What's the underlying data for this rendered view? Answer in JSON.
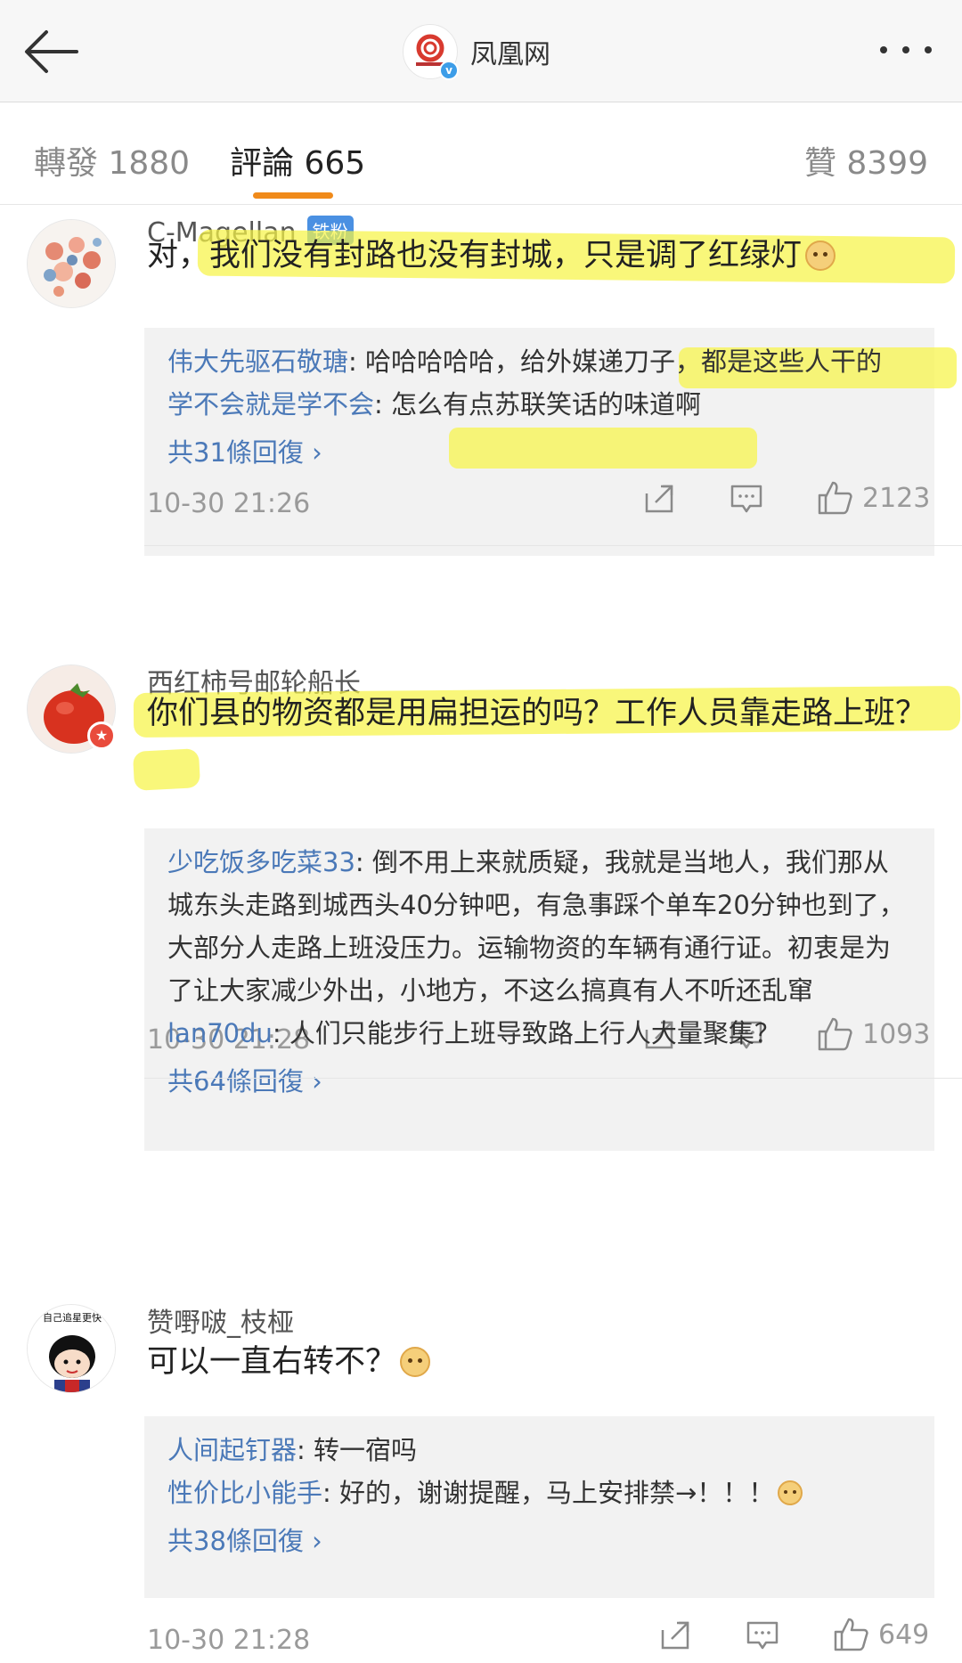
{
  "header": {
    "title": "凤凰网",
    "logo_text": "凤凰网",
    "verified_mark": "v"
  },
  "tabs": {
    "repost": "轉發 1880",
    "comments": "評論 665",
    "likes": "贊 8399"
  },
  "comments": [
    {
      "username": "C-Magellan",
      "badge": "铁粉",
      "text": "对，我们没有封路也没有封城，只是调了红绿灯",
      "replies": [
        {
          "name": "伟大先驱石敬瑭",
          "text": ": 哈哈哈哈哈，给外媒递刀子，都是这些人干的"
        },
        {
          "name": "学不会就是学不会",
          "text": ": 怎么有点苏联笑话的味道啊"
        }
      ],
      "more_replies": "共31條回復 ›",
      "time": "10-30 21:26",
      "likes": "2123"
    },
    {
      "username": "西红柿号邮轮船长",
      "badge": "",
      "text": "你们县的物资都是用扁担运的吗？工作人员靠走路上班？",
      "replies": [
        {
          "name": "少吃饭多吃菜33",
          "text": ": 倒不用上来就质疑，我就是当地人，我们那从城东头走路到城西头40分钟吧，有急事踩个单车20分钟也到了，大部分人走路上班没压力。运输物资的车辆有通行证。初衷是为了让大家减少外出，小地方，不这么搞真有人不听还乱窜"
        },
        {
          "name": "lan70du",
          "text": ": 人们只能步行上班导致路上行人大量聚集？"
        }
      ],
      "more_replies": "共64條回復 ›",
      "time": "10-30 21:28",
      "likes": "1093"
    },
    {
      "username": "赞嘢啵_枝桠",
      "badge": "",
      "text": "可以一直右转不？",
      "replies": [
        {
          "name": "人间起钉器",
          "text": ": 转一宿吗"
        },
        {
          "name": "性价比小能手",
          "text": ": 好的，谢谢提醒，马上安排禁→！！！"
        }
      ],
      "more_replies": "共38條回復 ›",
      "time": "10-30 21:28",
      "likes": "649"
    }
  ],
  "avatar3_caption": "自己追星更快",
  "colors": {
    "accent": "#f08a1a",
    "link": "#4b79b8",
    "highlight": "#f6f446",
    "badge": "#4a90e2"
  },
  "icons": [
    "back-arrow-icon",
    "more-dots-icon",
    "share-icon",
    "comment-icon",
    "like-icon",
    "doge-emoji-icon"
  ]
}
